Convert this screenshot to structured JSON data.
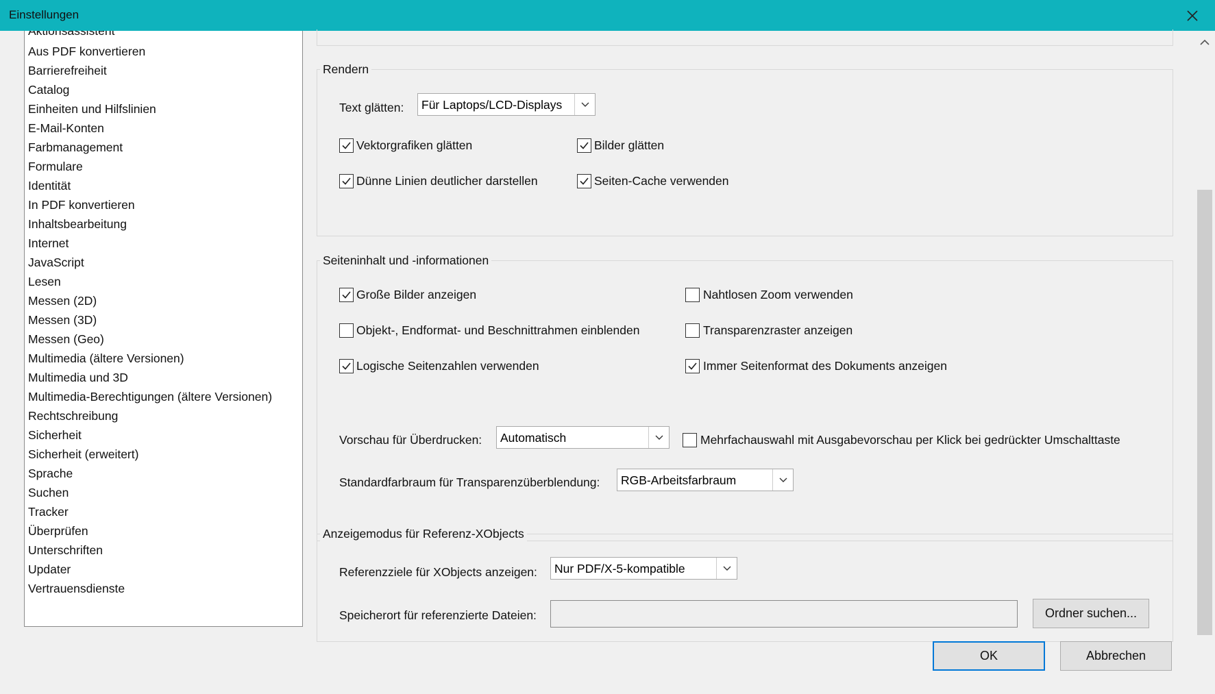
{
  "window": {
    "title": "Einstellungen"
  },
  "sidebar": {
    "items": [
      "Aktionsassistent",
      "Aus PDF konvertieren",
      "Barrierefreiheit",
      "Catalog",
      "Einheiten und Hilfslinien",
      "E-Mail-Konten",
      "Farbmanagement",
      "Formulare",
      "Identität",
      "In PDF konvertieren",
      "Inhaltsbearbeitung",
      "Internet",
      "JavaScript",
      "Lesen",
      "Messen (2D)",
      "Messen (3D)",
      "Messen (Geo)",
      "Multimedia (ältere Versionen)",
      "Multimedia und 3D",
      "Multimedia-Berechtigungen (ältere Versionen)",
      "Rechtschreibung",
      "Sicherheit",
      "Sicherheit (erweitert)",
      "Sprache",
      "Suchen",
      "Tracker",
      "Überprüfen",
      "Unterschriften",
      "Updater",
      "Vertrauensdienste"
    ]
  },
  "rendern": {
    "title": "Rendern",
    "text_smoothing_label": "Text glätten:",
    "text_smoothing_value": "Für Laptops/LCD-Displays",
    "vector_smoothing": {
      "label": "Vektorgrafiken glätten",
      "checked": true
    },
    "image_smoothing": {
      "label": "Bilder glätten",
      "checked": true
    },
    "thin_lines": {
      "label": "Dünne Linien deutlicher darstellen",
      "checked": true
    },
    "page_cache": {
      "label": "Seiten-Cache verwenden",
      "checked": true
    }
  },
  "page_content": {
    "title": "Seiteninhalt und -informationen",
    "large_images": {
      "label": "Große Bilder anzeigen",
      "checked": true
    },
    "smooth_zoom": {
      "label": "Nahtlosen Zoom verwenden",
      "checked": false
    },
    "art_trim_bleed": {
      "label": "Objekt-, Endformat- und Beschnittrahmen einblenden",
      "checked": false
    },
    "transparency_grid": {
      "label": "Transparenzraster anzeigen",
      "checked": false
    },
    "logical_page_numbers": {
      "label": "Logische Seitenzahlen verwenden",
      "checked": true
    },
    "always_page_size": {
      "label": "Immer Seitenformat des Dokuments anzeigen",
      "checked": true
    },
    "overprint_label": "Vorschau für Überdrucken:",
    "overprint_value": "Automatisch",
    "multi_select": {
      "label": "Mehrfachauswahl mit Ausgabevorschau per Klick bei gedrückter Umschalttaste",
      "checked": false
    },
    "blend_space_label": "Standardfarbraum für Transparenzüberblendung:",
    "blend_space_value": "RGB-Arbeitsfarbraum"
  },
  "xobjects": {
    "title": "Anzeigemodus für Referenz-XObjects",
    "targets_label": "Referenzziele für XObjects anzeigen:",
    "targets_value": "Nur PDF/X-5-kompatible",
    "location_label": "Speicherort für referenzierte Dateien:",
    "location_value": "",
    "browse_button": "Ordner suchen..."
  },
  "footer": {
    "ok": "OK",
    "cancel": "Abbrechen"
  },
  "colors": {
    "titlebar": "#0fb3bd",
    "focus": "#0078d7"
  }
}
